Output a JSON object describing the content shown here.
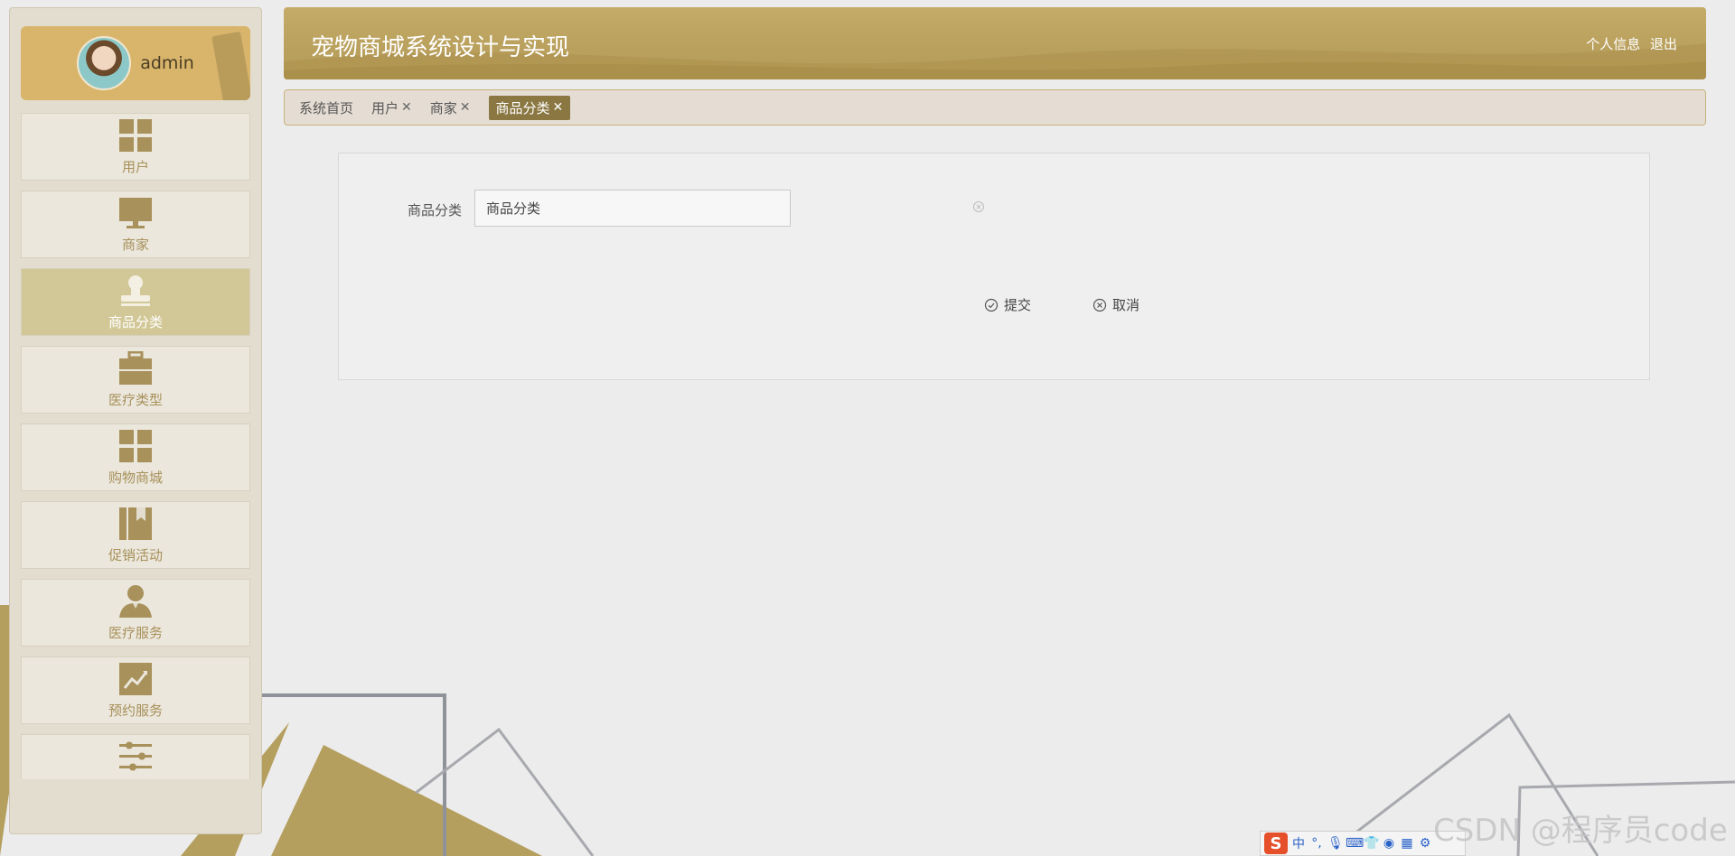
{
  "app": {
    "title": "宠物商城系统设计与实现",
    "user_name": "admin",
    "header_links": [
      "个人信息",
      "退出"
    ]
  },
  "sidebar": {
    "items": [
      {
        "label": "用户",
        "icon": "grid-icon",
        "active": false
      },
      {
        "label": "商家",
        "icon": "monitor-icon",
        "active": false
      },
      {
        "label": "商品分类",
        "icon": "stamp-icon",
        "active": true
      },
      {
        "label": "医疗类型",
        "icon": "briefcase-icon",
        "active": false
      },
      {
        "label": "购物商城",
        "icon": "grid-icon",
        "active": false
      },
      {
        "label": "促销活动",
        "icon": "book-icon",
        "active": false
      },
      {
        "label": "医疗服务",
        "icon": "person-icon",
        "active": false
      },
      {
        "label": "预约服务",
        "icon": "chart-icon",
        "active": false
      },
      {
        "label": "",
        "icon": "sliders-icon",
        "active": false
      }
    ]
  },
  "tabs": [
    {
      "label": "系统首页",
      "closable": false,
      "active": false
    },
    {
      "label": "用户",
      "closable": true,
      "active": false
    },
    {
      "label": "商家",
      "closable": true,
      "active": false
    },
    {
      "label": "商品分类",
      "closable": true,
      "active": true
    }
  ],
  "form": {
    "field_label": "商品分类",
    "field_value": "商品分类",
    "submit_label": "提交",
    "cancel_label": "取消"
  },
  "taskbar": {
    "ime_items": [
      "中",
      "°,"
    ]
  },
  "watermark": "CSDN @程序员code",
  "colors": {
    "accent": "#b9a05d",
    "sidebar_active": "#d2c796",
    "icon": "#a8915a",
    "tab_active": "#8a7742"
  }
}
